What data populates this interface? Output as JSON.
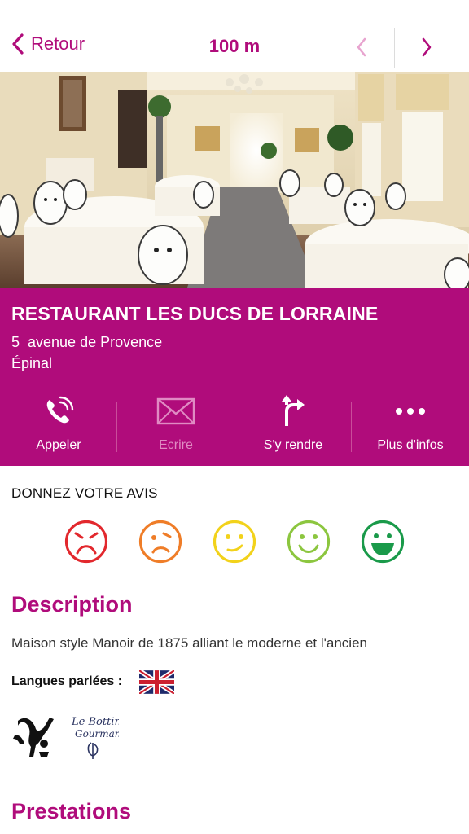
{
  "header": {
    "back_label": "Retour",
    "distance": "100 m"
  },
  "photo": {
    "alt": "Salle du restaurant"
  },
  "restaurant": {
    "name": "RESTAURANT LES DUCS DE LORRAINE",
    "address_line1": "5  avenue de Provence",
    "address_line2": "Épinal"
  },
  "actions": [
    {
      "label": "Appeler",
      "icon": "phone-icon",
      "enabled": true
    },
    {
      "label": "Ecrire",
      "icon": "mail-icon",
      "enabled": false
    },
    {
      "label": "S'y rendre",
      "icon": "directions-icon",
      "enabled": true
    },
    {
      "label": "Plus d'infos",
      "icon": "more-icon",
      "enabled": true
    }
  ],
  "feedback": {
    "title": "DONNEZ VOTRE AVIS",
    "faces": [
      {
        "icon": "very-unhappy-face-icon",
        "color": "#e2282d"
      },
      {
        "icon": "unhappy-face-icon",
        "color": "#ef7d28"
      },
      {
        "icon": "neutral-face-icon",
        "color": "#f2d21b"
      },
      {
        "icon": "happy-face-icon",
        "color": "#8cc63f"
      },
      {
        "icon": "very-happy-face-icon",
        "color": "#1a9a4a"
      }
    ]
  },
  "description": {
    "title": "Description",
    "text": "Maison style Manoir de 1875 alliant le moderne et l'ancien",
    "languages_label": "Langues parlées :",
    "languages": [
      "english-flag-icon"
    ],
    "labels": [
      "guide-logo-icon",
      "bottin-gourmand-logo-icon"
    ]
  },
  "prestations": {
    "title": "Prestations"
  },
  "colors": {
    "brand": "#b00c7b",
    "disabled": "#e08bc3"
  }
}
